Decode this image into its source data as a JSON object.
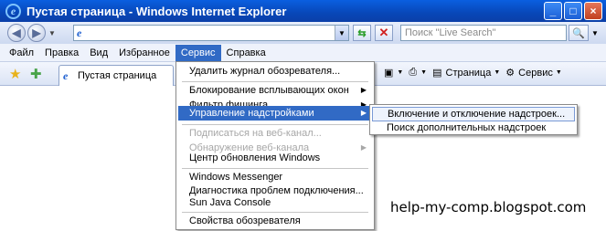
{
  "window": {
    "title": "Пустая страница - Windows Internet Explorer",
    "min": "_",
    "max": "□",
    "close": "×"
  },
  "nav": {
    "back": "◀",
    "forward": "▶",
    "address_value": "",
    "search_placeholder": "Поиск \"Live Search\""
  },
  "menubar": [
    "Файл",
    "Правка",
    "Вид",
    "Избранное",
    "Сервис",
    "Справка"
  ],
  "tab": {
    "label": "Пустая страница"
  },
  "toolbar": {
    "page_label": "Страница",
    "tools_label": "Сервис"
  },
  "dropdown": {
    "items": [
      {
        "label": "Удалить журнал обозревателя...",
        "state": "normal"
      },
      {
        "label": "Блокирование всплывающих окон",
        "state": "normal",
        "submenu": true
      },
      {
        "label": "Фильтр фишинга",
        "state": "normal",
        "submenu": true
      },
      {
        "label": "Управление надстройками",
        "state": "highlighted",
        "submenu": true
      },
      {
        "label": "Подписаться на веб-канал...",
        "state": "disabled"
      },
      {
        "label": "Обнаружение веб-канала",
        "state": "disabled",
        "submenu": true
      },
      {
        "label": "Центр обновления Windows",
        "state": "normal"
      },
      {
        "label": "Windows Messenger",
        "state": "normal"
      },
      {
        "label": "Диагностика проблем подключения...",
        "state": "normal"
      },
      {
        "label": "Sun Java Console",
        "state": "normal"
      },
      {
        "label": "Свойства обозревателя",
        "state": "normal"
      }
    ]
  },
  "submenu": {
    "items": [
      {
        "label": "Включение и отключение надстроек...",
        "state": "hover"
      },
      {
        "label": "Поиск дополнительных надстроек",
        "state": "normal"
      }
    ]
  },
  "watermark": "help-my-comp.blogspot.com",
  "icons": {
    "ie": "ie-logo-icon",
    "star": "favorites-star-icon",
    "add_fav": "add-favorites-icon",
    "feed": "feed-icon",
    "print": "printer-icon",
    "page": "page-icon",
    "gear": "gear-icon",
    "search": "magnifier-icon",
    "go": "go-arrows-icon",
    "stop": "stop-icon"
  },
  "colors": {
    "title_bar": "#0847b8",
    "highlight": "#316ac5",
    "disabled_text": "#a7a7a7"
  }
}
